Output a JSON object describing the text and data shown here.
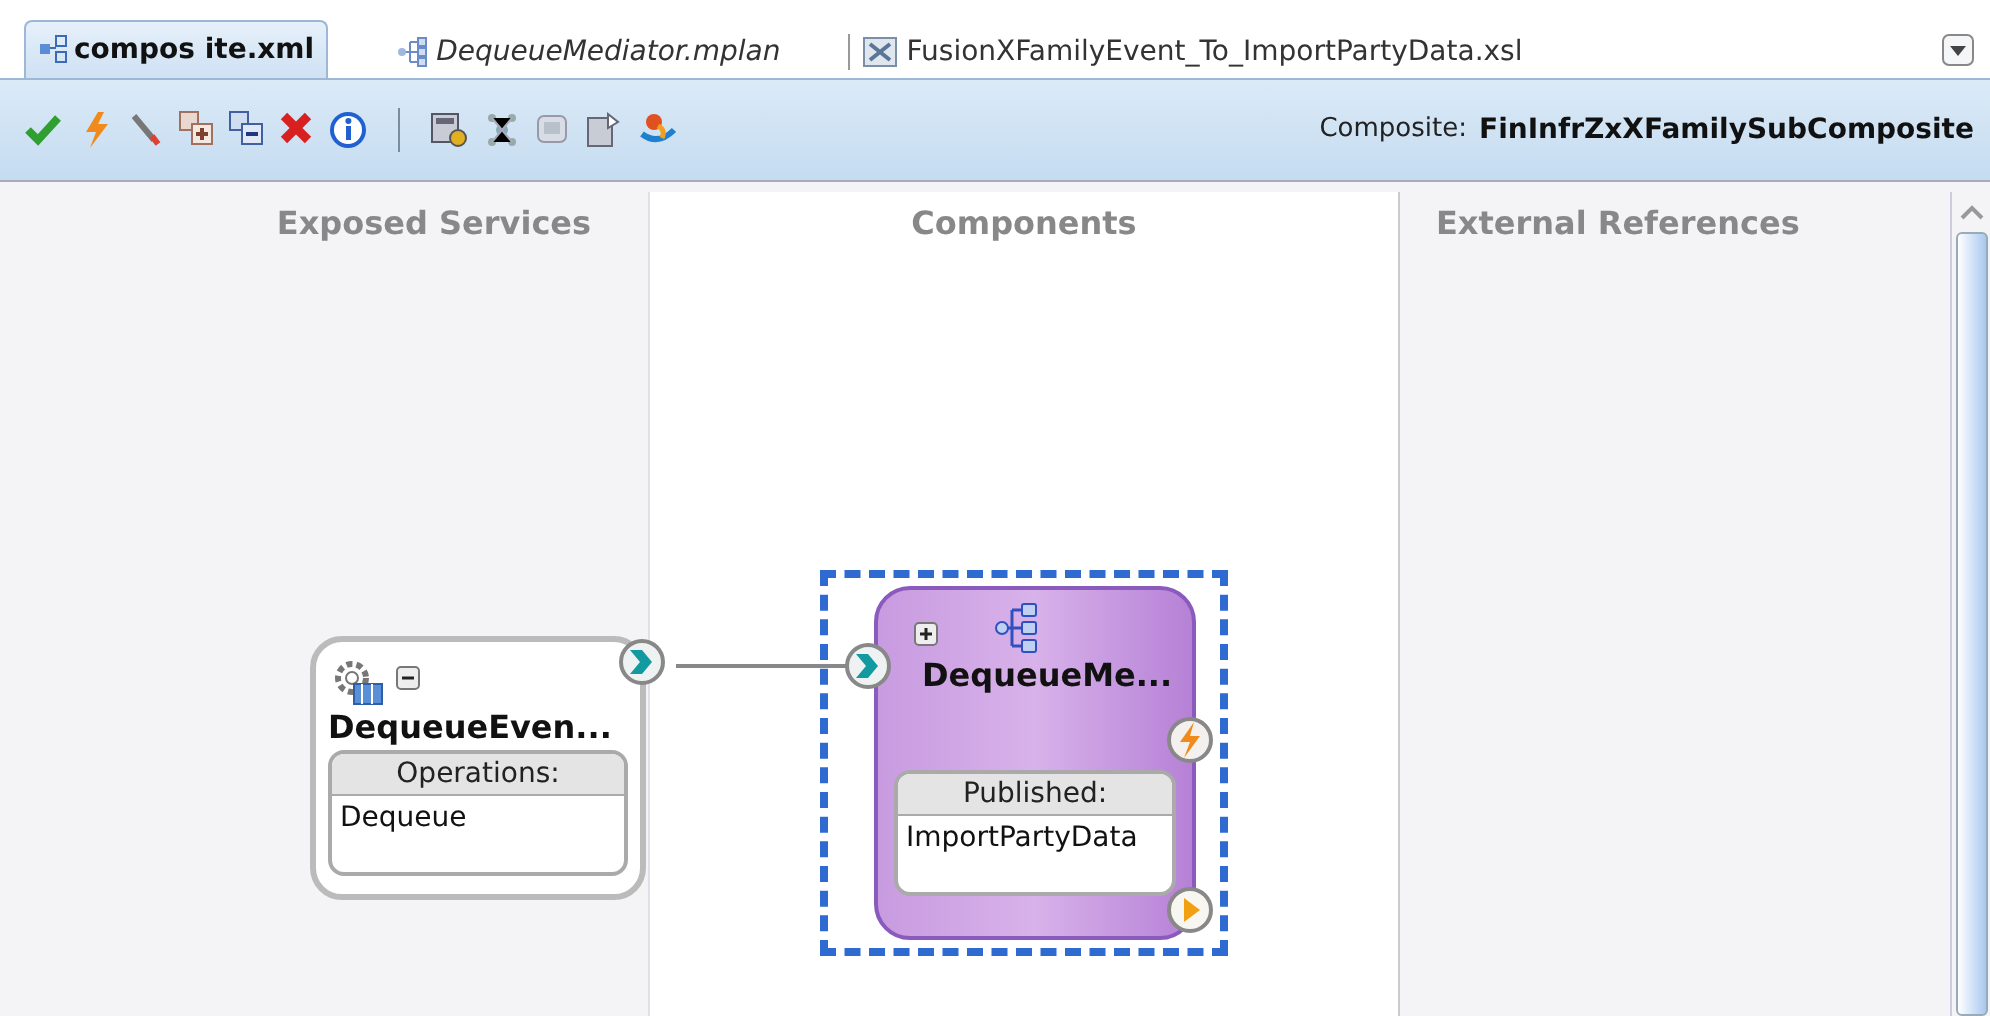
{
  "tabs": [
    {
      "label": "compos ite.xml",
      "selected": true,
      "kind": "composite"
    },
    {
      "label": "DequeueMediator.mplan",
      "selected": false,
      "kind": "mplan"
    },
    {
      "label": "FusionXFamilyEvent_To_ImportPartyData.xsl",
      "selected": false,
      "kind": "xsl"
    }
  ],
  "toolbar": {
    "composite_label": "Composite:",
    "composite_name": "FinInfrZxXFamilySubComposite"
  },
  "swimlanes": [
    "Exposed Services",
    "Components",
    "External References"
  ],
  "service": {
    "title": "DequeueEven...",
    "expanded": true,
    "section_header": "Operations:",
    "operations": [
      "Dequeue"
    ]
  },
  "component": {
    "title": "DequeueMe...",
    "expanded": false,
    "selected": true,
    "section_header": "Published:",
    "items": [
      "ImportPartyData"
    ]
  }
}
